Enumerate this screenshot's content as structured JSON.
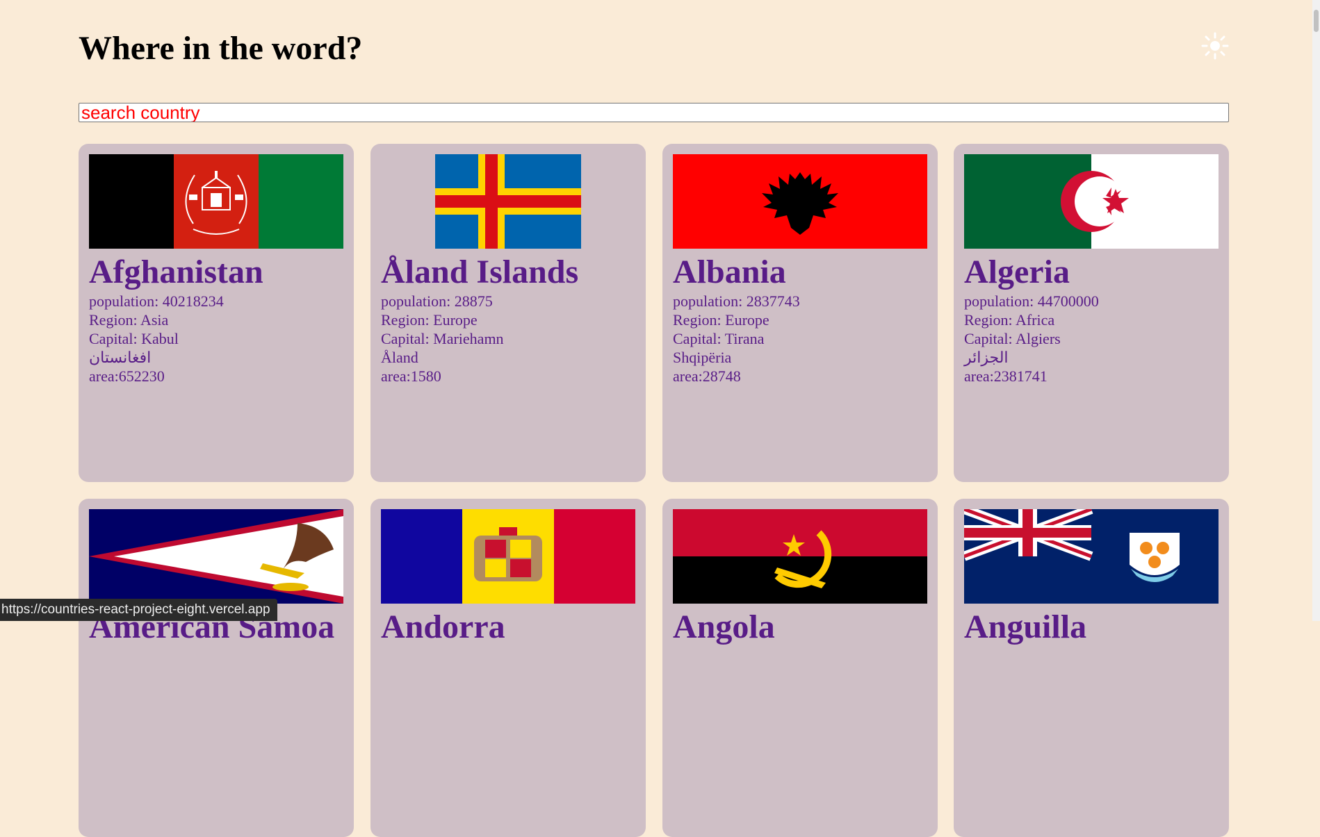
{
  "header": {
    "title": "Where in the word?",
    "theme_icon": "sun-icon"
  },
  "search": {
    "placeholder": "search country",
    "value": ""
  },
  "countries": [
    {
      "name": "Afghanistan",
      "population": "population: 40218234",
      "region": "Region: Asia",
      "capital": "Capital: Kabul",
      "native": "افغانستان",
      "area": "area:652230",
      "flag": "afghanistan-flag"
    },
    {
      "name": "Åland Islands",
      "population": "population: 28875",
      "region": "Region: Europe",
      "capital": "Capital: Mariehamn",
      "native": "Åland",
      "area": "area:1580",
      "flag": "aland-flag"
    },
    {
      "name": "Albania",
      "population": "population: 2837743",
      "region": "Region: Europe",
      "capital": "Capital: Tirana",
      "native": "Shqipëria",
      "area": "area:28748",
      "flag": "albania-flag"
    },
    {
      "name": "Algeria",
      "population": "population: 44700000",
      "region": "Region: Africa",
      "capital": "Capital: Algiers",
      "native": "الجزائر",
      "area": "area:2381741",
      "flag": "algeria-flag"
    },
    {
      "name": "American Samoa",
      "flag": "american-samoa-flag"
    },
    {
      "name": "Andorra",
      "flag": "andorra-flag"
    },
    {
      "name": "Angola",
      "flag": "angola-flag"
    },
    {
      "name": "Anguilla",
      "flag": "anguilla-flag"
    }
  ],
  "colors": {
    "background": "#faebd7",
    "card": "#cfbfc6",
    "card_text": "#581c87",
    "placeholder": "#ff0000"
  },
  "status_bar": {
    "url": "https://countries-react-project-eight.vercel.app"
  }
}
